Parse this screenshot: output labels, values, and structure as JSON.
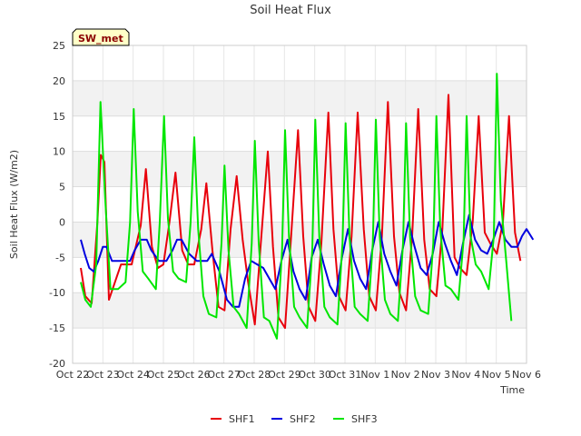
{
  "chart_data": {
    "type": "line",
    "title": "Soil Heat Flux",
    "badge": "SW_met",
    "xlabel": "Time",
    "ylabel": "Soil Heat Flux (W/m2)",
    "xlim": [
      "2023-10-22",
      "2023-11-06"
    ],
    "ylim": [
      -20,
      25
    ],
    "yticks": [
      -20,
      -15,
      -10,
      -5,
      0,
      5,
      10,
      15,
      20,
      25
    ],
    "xticks": [
      "Oct 22",
      "Oct 23",
      "Oct 24",
      "Oct 25",
      "Oct 26",
      "Oct 27",
      "Oct 28",
      "Oct 29",
      "Oct 30",
      "Oct 31",
      "Nov 1",
      "Nov 2",
      "Nov 3",
      "Nov 4",
      "Nov 5",
      "Nov 6"
    ],
    "grid": true,
    "legend_position": "bottom-center",
    "series": [
      {
        "name": "SHF1",
        "color": "#e8000b",
        "x": [
          0.27,
          0.42,
          0.63,
          0.82,
          0.93,
          1.05,
          1.2,
          1.6,
          1.95,
          2.25,
          2.42,
          2.62,
          2.82,
          3.0,
          3.2,
          3.4,
          3.62,
          3.82,
          4.02,
          4.25,
          4.42,
          4.62,
          4.82,
          5.02,
          5.22,
          5.42,
          5.62,
          5.8,
          6.02,
          6.22,
          6.45,
          6.62,
          6.8,
          7.02,
          7.22,
          7.45,
          7.62,
          7.8,
          8.02,
          8.22,
          8.45,
          8.62,
          8.8,
          9.02,
          9.22,
          9.42,
          9.62,
          9.8,
          10.02,
          10.22,
          10.42,
          10.62,
          10.8,
          11.02,
          11.22,
          11.42,
          11.62,
          11.8,
          12.02,
          12.22,
          12.42,
          12.62,
          12.8,
          13.02,
          13.22,
          13.42,
          13.62,
          13.8,
          14.02,
          14.22,
          14.42,
          14.62,
          14.8,
          15.0,
          15.22
        ],
        "y": [
          -6.5,
          -10.5,
          -11.5,
          0.0,
          9.5,
          8.5,
          -11.0,
          -6.0,
          -6.0,
          -0.5,
          7.5,
          -3.5,
          -6.5,
          -6.0,
          0.0,
          7.0,
          -4.0,
          -6.0,
          -6.0,
          -1.0,
          5.5,
          -4.0,
          -12.0,
          -12.5,
          -1.0,
          6.5,
          -2.5,
          -8.5,
          -14.5,
          -3.0,
          10.0,
          -3.5,
          -13.5,
          -15.0,
          -2.0,
          13.0,
          -2.0,
          -12.0,
          -14.0,
          -3.0,
          15.5,
          -1.0,
          -10.5,
          -12.5,
          -2.0,
          15.5,
          -1.0,
          -10.5,
          -12.5,
          -2.0,
          17.0,
          -2.0,
          -10.0,
          -12.5,
          -2.0,
          16.0,
          -2.5,
          -9.5,
          -10.5,
          -1.0,
          18.0,
          -5.0,
          -6.5,
          -7.5,
          0.0,
          15.0,
          -1.5,
          -3.0,
          -4.5,
          0.0,
          15.0,
          -1.5,
          -5.5,
          null,
          null
        ]
      },
      {
        "name": "SHF2",
        "color": "#0000e0",
        "x": [
          0.27,
          0.4,
          0.55,
          0.7,
          0.85,
          1.0,
          1.12,
          1.3,
          1.6,
          1.9,
          2.05,
          2.25,
          2.45,
          2.6,
          2.85,
          3.1,
          3.3,
          3.45,
          3.6,
          3.85,
          4.1,
          4.3,
          4.45,
          4.6,
          4.85,
          5.1,
          5.3,
          5.5,
          5.7,
          5.9,
          6.1,
          6.3,
          6.5,
          6.7,
          6.9,
          7.1,
          7.3,
          7.5,
          7.7,
          7.9,
          8.1,
          8.3,
          8.5,
          8.7,
          8.9,
          9.1,
          9.3,
          9.5,
          9.7,
          9.9,
          10.1,
          10.3,
          10.5,
          10.7,
          10.9,
          11.1,
          11.3,
          11.5,
          11.7,
          11.9,
          12.1,
          12.3,
          12.5,
          12.7,
          12.9,
          13.1,
          13.3,
          13.5,
          13.7,
          13.9,
          14.1,
          14.3,
          14.5,
          14.7,
          14.85,
          15.0,
          15.22
        ],
        "y": [
          -2.5,
          -4.5,
          -6.5,
          -7.0,
          -5.5,
          -3.5,
          -3.5,
          -5.5,
          -5.5,
          -5.5,
          -4.0,
          -2.5,
          -2.5,
          -4.0,
          -5.5,
          -5.5,
          -4.0,
          -2.5,
          -2.5,
          -4.5,
          -5.5,
          -5.5,
          -5.5,
          -4.5,
          -7.0,
          -11.0,
          -12.0,
          -12.0,
          -8.0,
          -5.5,
          -6.0,
          -6.5,
          -8.0,
          -9.5,
          -5.5,
          -2.5,
          -7.0,
          -9.5,
          -11.0,
          -5.0,
          -2.5,
          -6.0,
          -9.0,
          -10.5,
          -5.0,
          -1.0,
          -5.5,
          -8.0,
          -9.5,
          -4.0,
          0.0,
          -4.5,
          -7.0,
          -9.0,
          -4.0,
          0.0,
          -3.5,
          -6.5,
          -7.5,
          -4.5,
          0.0,
          -3.0,
          -5.5,
          -7.5,
          -3.0,
          1.0,
          -2.5,
          -4.0,
          -4.5,
          -2.5,
          0.0,
          -2.5,
          -3.5,
          -3.5,
          -2.0,
          -1.0,
          -2.5
        ]
      },
      {
        "name": "SHF3",
        "color": "#00e600",
        "x": [
          0.27,
          0.42,
          0.6,
          0.78,
          0.92,
          1.08,
          1.25,
          1.5,
          1.75,
          1.9,
          2.02,
          2.15,
          2.32,
          2.5,
          2.75,
          2.88,
          3.02,
          3.15,
          3.32,
          3.5,
          3.75,
          3.9,
          4.02,
          4.15,
          4.32,
          4.5,
          4.75,
          4.92,
          5.02,
          5.15,
          5.32,
          5.5,
          5.75,
          5.92,
          6.02,
          6.15,
          6.32,
          6.5,
          6.75,
          6.92,
          7.02,
          7.15,
          7.32,
          7.5,
          7.75,
          7.92,
          8.02,
          8.15,
          8.32,
          8.5,
          8.75,
          8.92,
          9.02,
          9.15,
          9.32,
          9.5,
          9.75,
          9.92,
          10.02,
          10.15,
          10.32,
          10.5,
          10.75,
          10.92,
          11.02,
          11.15,
          11.32,
          11.5,
          11.75,
          11.92,
          12.02,
          12.15,
          12.32,
          12.5,
          12.75,
          12.92,
          13.02,
          13.15,
          13.32,
          13.5,
          13.75,
          13.92,
          14.02,
          14.15,
          14.32,
          14.5,
          14.75,
          14.92,
          15.02,
          15.15
        ],
        "y": [
          -8.5,
          -11.0,
          -12.0,
          -6.0,
          17.0,
          3.0,
          -9.5,
          -9.5,
          -8.5,
          0.0,
          16.0,
          1.5,
          -7.0,
          -8.0,
          -9.5,
          0.0,
          15.0,
          0.5,
          -7.0,
          -8.0,
          -8.5,
          0.0,
          12.0,
          -1.0,
          -10.5,
          -13.0,
          -13.5,
          -3.0,
          8.0,
          -4.0,
          -12.0,
          -13.0,
          -15.0,
          -3.0,
          11.5,
          -3.0,
          -13.5,
          -14.0,
          -16.5,
          -4.0,
          13.0,
          -2.0,
          -12.0,
          -13.5,
          -15.0,
          -4.0,
          14.5,
          -2.0,
          -12.0,
          -13.5,
          -14.5,
          -3.0,
          14.0,
          -2.0,
          -12.0,
          -13.0,
          -14.0,
          -3.0,
          14.5,
          -2.0,
          -11.0,
          -13.0,
          -14.0,
          -3.0,
          14.0,
          -2.0,
          -10.5,
          -12.5,
          -13.0,
          -3.0,
          15.0,
          -1.0,
          -9.0,
          -9.5,
          -11.0,
          -2.5,
          15.0,
          -2.0,
          -6.0,
          -7.0,
          -9.5,
          -2.0,
          21.0,
          3.0,
          -5.0,
          -14.0,
          null,
          null,
          null,
          null
        ]
      }
    ]
  }
}
